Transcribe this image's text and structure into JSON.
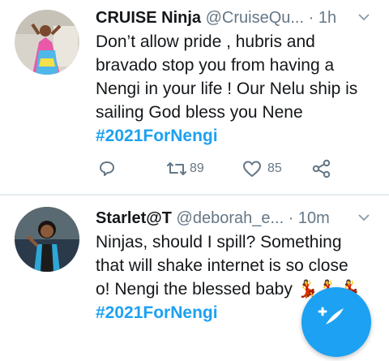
{
  "tweets": [
    {
      "name": "CRUISE Ninja",
      "handle": "@CruiseQu...",
      "time": "· 1h",
      "lines": [
        "Don’t allow pride , hubris and",
        "bravado stop you from having a",
        "Nengi in your life ! Our Nelu ship is",
        "sailing God bless you Nene"
      ],
      "hashtag": "#2021ForNengi",
      "retweets": "89",
      "likes": "85",
      "icons": [
        "reply-icon",
        "retweet-icon",
        "like-icon",
        "share-icon"
      ]
    },
    {
      "name": "Starlet@T",
      "handle": "@deborah_e...",
      "time": "· 10m",
      "lines": [
        "Ninjas, should I spill? Something",
        "that will shake internet is so close",
        "o! Nengi the blessed baby"
      ],
      "emoji": "💃💃💃",
      "hashtag": "#2021ForNengi"
    }
  ],
  "colors": {
    "accent": "#1da1f2",
    "secondary_text": "#657786",
    "divider": "#e6ecf0"
  },
  "fab": {
    "icon": "compose-tweet-icon"
  }
}
